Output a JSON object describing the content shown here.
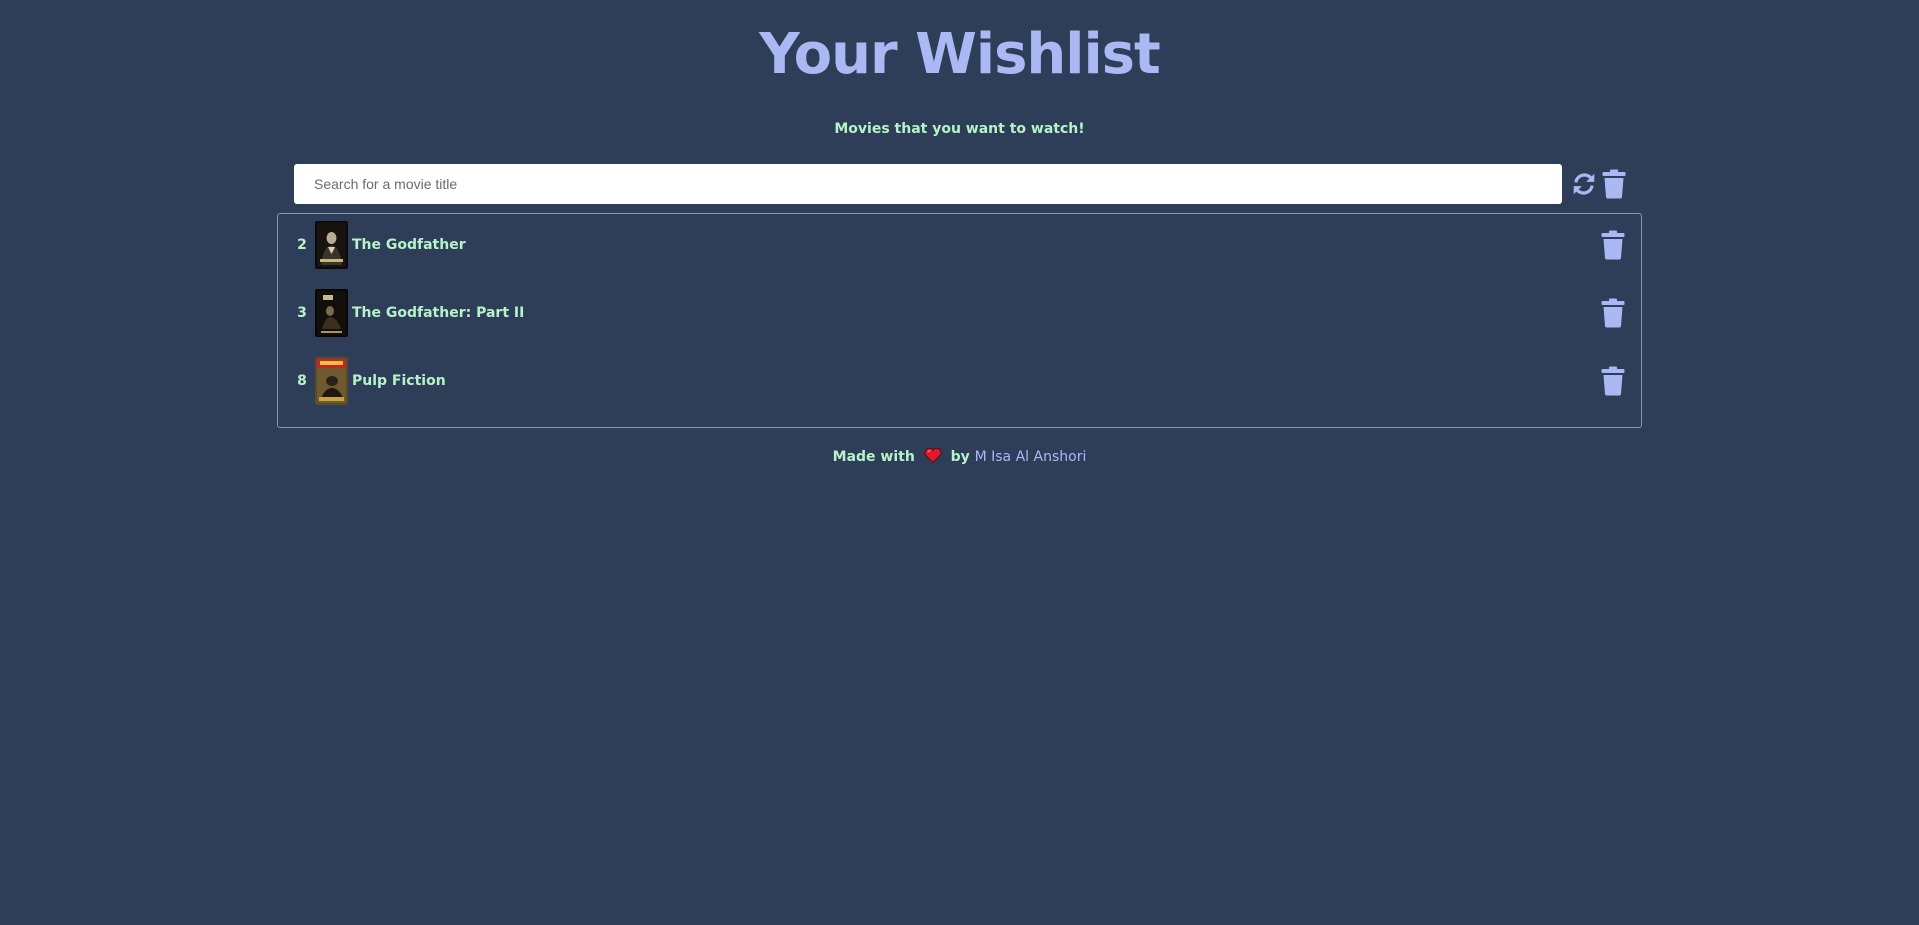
{
  "header": {
    "title": "Your Wishlist",
    "subtitle": "Movies that you want to watch!"
  },
  "search": {
    "placeholder": "Search for a movie title",
    "value": ""
  },
  "toolbar": {
    "refresh_icon": "refresh-icon",
    "clear_icon": "trash-icon"
  },
  "movies": [
    {
      "rank": "2",
      "title": "The Godfather",
      "poster": "poster-image"
    },
    {
      "rank": "3",
      "title": "The Godfather: Part II",
      "poster": "poster-image"
    },
    {
      "rank": "8",
      "title": "Pulp Fiction",
      "poster": "poster-image"
    }
  ],
  "footer": {
    "made_with": "Made with",
    "by": "by",
    "author": "M Isa Al Anshori"
  },
  "colors": {
    "background": "#2e3d58",
    "accent": "#aab8f4",
    "text": "#b6f3c8",
    "heart": "#e0182b"
  }
}
